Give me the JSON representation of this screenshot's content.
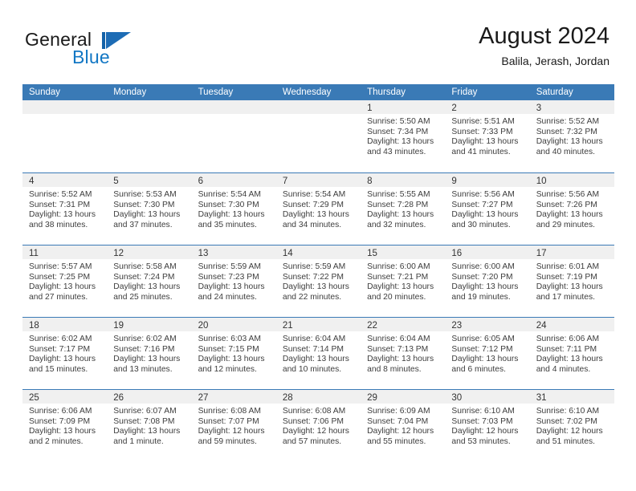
{
  "brand": {
    "name_part1": "General",
    "name_part2": "Blue",
    "mark": "triangle-logo"
  },
  "header": {
    "title": "August 2024",
    "location": "Balila, Jerash, Jordan"
  },
  "colors": {
    "header_blue": "#3a7ab6",
    "brand_blue": "#1277c4",
    "day_band": "#f0f0f0",
    "text": "#3d3d3d"
  },
  "weekdays": [
    "Sunday",
    "Monday",
    "Tuesday",
    "Wednesday",
    "Thursday",
    "Friday",
    "Saturday"
  ],
  "labels": {
    "sunrise": "Sunrise:",
    "sunset": "Sunset:",
    "daylight": "Daylight:"
  },
  "weeks": [
    [
      {
        "day": "",
        "empty": true
      },
      {
        "day": "",
        "empty": true
      },
      {
        "day": "",
        "empty": true
      },
      {
        "day": "",
        "empty": true
      },
      {
        "day": "1",
        "sunrise": "Sunrise: 5:50 AM",
        "sunset": "Sunset: 7:34 PM",
        "daylight_1": "Daylight: 13 hours",
        "daylight_2": "and 43 minutes."
      },
      {
        "day": "2",
        "sunrise": "Sunrise: 5:51 AM",
        "sunset": "Sunset: 7:33 PM",
        "daylight_1": "Daylight: 13 hours",
        "daylight_2": "and 41 minutes."
      },
      {
        "day": "3",
        "sunrise": "Sunrise: 5:52 AM",
        "sunset": "Sunset: 7:32 PM",
        "daylight_1": "Daylight: 13 hours",
        "daylight_2": "and 40 minutes."
      }
    ],
    [
      {
        "day": "4",
        "sunrise": "Sunrise: 5:52 AM",
        "sunset": "Sunset: 7:31 PM",
        "daylight_1": "Daylight: 13 hours",
        "daylight_2": "and 38 minutes."
      },
      {
        "day": "5",
        "sunrise": "Sunrise: 5:53 AM",
        "sunset": "Sunset: 7:30 PM",
        "daylight_1": "Daylight: 13 hours",
        "daylight_2": "and 37 minutes."
      },
      {
        "day": "6",
        "sunrise": "Sunrise: 5:54 AM",
        "sunset": "Sunset: 7:30 PM",
        "daylight_1": "Daylight: 13 hours",
        "daylight_2": "and 35 minutes."
      },
      {
        "day": "7",
        "sunrise": "Sunrise: 5:54 AM",
        "sunset": "Sunset: 7:29 PM",
        "daylight_1": "Daylight: 13 hours",
        "daylight_2": "and 34 minutes."
      },
      {
        "day": "8",
        "sunrise": "Sunrise: 5:55 AM",
        "sunset": "Sunset: 7:28 PM",
        "daylight_1": "Daylight: 13 hours",
        "daylight_2": "and 32 minutes."
      },
      {
        "day": "9",
        "sunrise": "Sunrise: 5:56 AM",
        "sunset": "Sunset: 7:27 PM",
        "daylight_1": "Daylight: 13 hours",
        "daylight_2": "and 30 minutes."
      },
      {
        "day": "10",
        "sunrise": "Sunrise: 5:56 AM",
        "sunset": "Sunset: 7:26 PM",
        "daylight_1": "Daylight: 13 hours",
        "daylight_2": "and 29 minutes."
      }
    ],
    [
      {
        "day": "11",
        "sunrise": "Sunrise: 5:57 AM",
        "sunset": "Sunset: 7:25 PM",
        "daylight_1": "Daylight: 13 hours",
        "daylight_2": "and 27 minutes."
      },
      {
        "day": "12",
        "sunrise": "Sunrise: 5:58 AM",
        "sunset": "Sunset: 7:24 PM",
        "daylight_1": "Daylight: 13 hours",
        "daylight_2": "and 25 minutes."
      },
      {
        "day": "13",
        "sunrise": "Sunrise: 5:59 AM",
        "sunset": "Sunset: 7:23 PM",
        "daylight_1": "Daylight: 13 hours",
        "daylight_2": "and 24 minutes."
      },
      {
        "day": "14",
        "sunrise": "Sunrise: 5:59 AM",
        "sunset": "Sunset: 7:22 PM",
        "daylight_1": "Daylight: 13 hours",
        "daylight_2": "and 22 minutes."
      },
      {
        "day": "15",
        "sunrise": "Sunrise: 6:00 AM",
        "sunset": "Sunset: 7:21 PM",
        "daylight_1": "Daylight: 13 hours",
        "daylight_2": "and 20 minutes."
      },
      {
        "day": "16",
        "sunrise": "Sunrise: 6:00 AM",
        "sunset": "Sunset: 7:20 PM",
        "daylight_1": "Daylight: 13 hours",
        "daylight_2": "and 19 minutes."
      },
      {
        "day": "17",
        "sunrise": "Sunrise: 6:01 AM",
        "sunset": "Sunset: 7:19 PM",
        "daylight_1": "Daylight: 13 hours",
        "daylight_2": "and 17 minutes."
      }
    ],
    [
      {
        "day": "18",
        "sunrise": "Sunrise: 6:02 AM",
        "sunset": "Sunset: 7:17 PM",
        "daylight_1": "Daylight: 13 hours",
        "daylight_2": "and 15 minutes."
      },
      {
        "day": "19",
        "sunrise": "Sunrise: 6:02 AM",
        "sunset": "Sunset: 7:16 PM",
        "daylight_1": "Daylight: 13 hours",
        "daylight_2": "and 13 minutes."
      },
      {
        "day": "20",
        "sunrise": "Sunrise: 6:03 AM",
        "sunset": "Sunset: 7:15 PM",
        "daylight_1": "Daylight: 13 hours",
        "daylight_2": "and 12 minutes."
      },
      {
        "day": "21",
        "sunrise": "Sunrise: 6:04 AM",
        "sunset": "Sunset: 7:14 PM",
        "daylight_1": "Daylight: 13 hours",
        "daylight_2": "and 10 minutes."
      },
      {
        "day": "22",
        "sunrise": "Sunrise: 6:04 AM",
        "sunset": "Sunset: 7:13 PM",
        "daylight_1": "Daylight: 13 hours",
        "daylight_2": "and 8 minutes."
      },
      {
        "day": "23",
        "sunrise": "Sunrise: 6:05 AM",
        "sunset": "Sunset: 7:12 PM",
        "daylight_1": "Daylight: 13 hours",
        "daylight_2": "and 6 minutes."
      },
      {
        "day": "24",
        "sunrise": "Sunrise: 6:06 AM",
        "sunset": "Sunset: 7:11 PM",
        "daylight_1": "Daylight: 13 hours",
        "daylight_2": "and 4 minutes."
      }
    ],
    [
      {
        "day": "25",
        "sunrise": "Sunrise: 6:06 AM",
        "sunset": "Sunset: 7:09 PM",
        "daylight_1": "Daylight: 13 hours",
        "daylight_2": "and 2 minutes."
      },
      {
        "day": "26",
        "sunrise": "Sunrise: 6:07 AM",
        "sunset": "Sunset: 7:08 PM",
        "daylight_1": "Daylight: 13 hours",
        "daylight_2": "and 1 minute."
      },
      {
        "day": "27",
        "sunrise": "Sunrise: 6:08 AM",
        "sunset": "Sunset: 7:07 PM",
        "daylight_1": "Daylight: 12 hours",
        "daylight_2": "and 59 minutes."
      },
      {
        "day": "28",
        "sunrise": "Sunrise: 6:08 AM",
        "sunset": "Sunset: 7:06 PM",
        "daylight_1": "Daylight: 12 hours",
        "daylight_2": "and 57 minutes."
      },
      {
        "day": "29",
        "sunrise": "Sunrise: 6:09 AM",
        "sunset": "Sunset: 7:04 PM",
        "daylight_1": "Daylight: 12 hours",
        "daylight_2": "and 55 minutes."
      },
      {
        "day": "30",
        "sunrise": "Sunrise: 6:10 AM",
        "sunset": "Sunset: 7:03 PM",
        "daylight_1": "Daylight: 12 hours",
        "daylight_2": "and 53 minutes."
      },
      {
        "day": "31",
        "sunrise": "Sunrise: 6:10 AM",
        "sunset": "Sunset: 7:02 PM",
        "daylight_1": "Daylight: 12 hours",
        "daylight_2": "and 51 minutes."
      }
    ]
  ]
}
